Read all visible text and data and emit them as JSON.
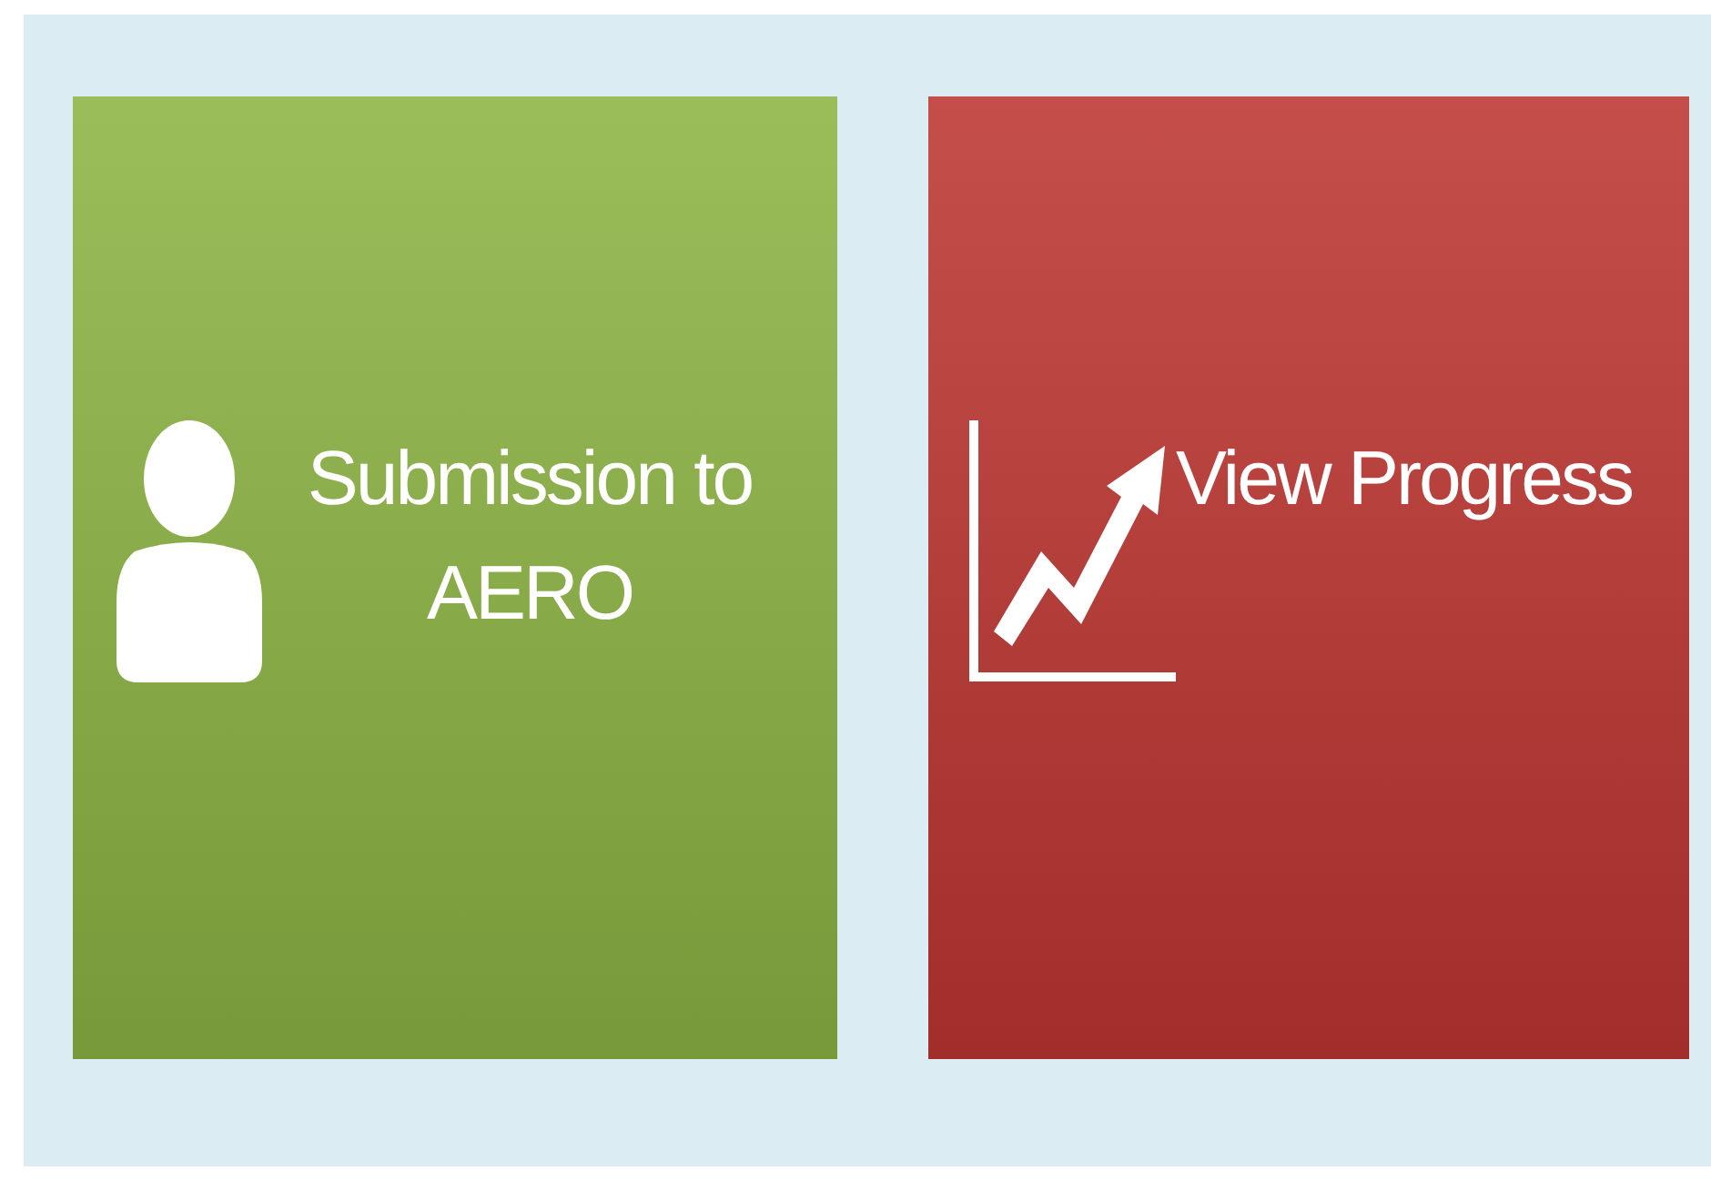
{
  "tiles": [
    {
      "kind": "person",
      "label": "Submission to AERO",
      "color": "#8db443"
    },
    {
      "kind": "chart",
      "label": "View Progress",
      "color": "#bd3632"
    }
  ]
}
